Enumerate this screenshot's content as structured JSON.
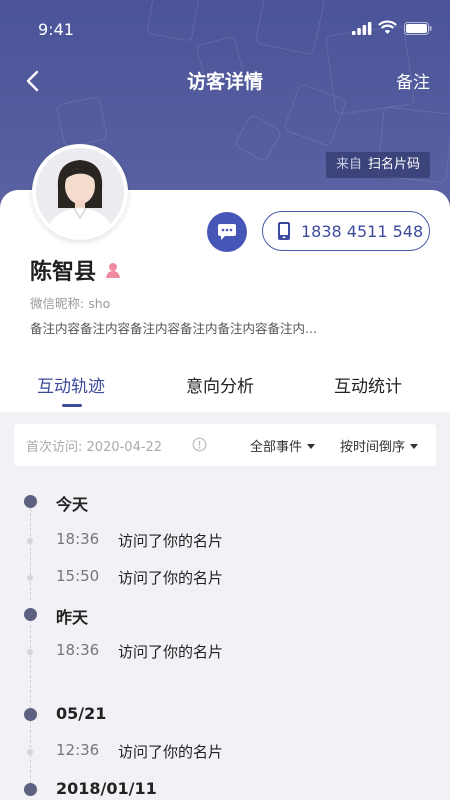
{
  "status_bar": {
    "time": "9:41"
  },
  "nav": {
    "title": "访客详情",
    "note": "备注"
  },
  "source": {
    "prefix": "来自",
    "value": "扫名片码"
  },
  "visitor": {
    "name": "陈智县",
    "wechat_label": "微信昵称:",
    "wechat_value": "sho",
    "remark": "备注内容备注内容备注内容备注内备注内容备注内..."
  },
  "phone": "1838 4511 548",
  "tabs": [
    "互动轨迹",
    "意向分析",
    "互动统计"
  ],
  "filter": {
    "first_visit_label": "首次访问:",
    "first_visit_date": "2020-04-22",
    "events": "全部事件",
    "sort": "按时间倒序"
  },
  "timeline": [
    {
      "label": "今天",
      "items": [
        {
          "time": "18:36",
          "desc": "访问了你的名片"
        },
        {
          "time": "15:50",
          "desc": "访问了你的名片"
        }
      ]
    },
    {
      "label": "昨天",
      "items": [
        {
          "time": "18:36",
          "desc": "访问了你的名片"
        }
      ]
    },
    {
      "label": "05/21",
      "items": [
        {
          "time": "12:36",
          "desc": "访问了你的名片"
        }
      ]
    },
    {
      "label": "2018/01/11",
      "items": []
    }
  ],
  "colors": {
    "header_bg": "#4b5499",
    "accent": "#3d4b9c",
    "chat_button": "#4656b6",
    "gender_icon": "#f08aa0"
  },
  "icons": {
    "back": "chevron-left-icon",
    "chat": "chat-bubble-icon",
    "phone": "mobile-phone-icon",
    "gender": "female-user-icon",
    "info": "info-circle-icon"
  }
}
